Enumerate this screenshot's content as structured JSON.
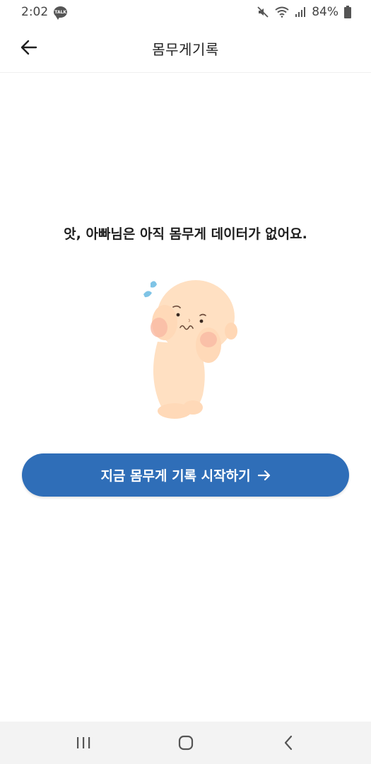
{
  "status_bar": {
    "time": "2:02",
    "talk_badge": "TALK",
    "battery": "84%"
  },
  "header": {
    "title": "몸무게기록"
  },
  "empty_state": {
    "message": "앗, 아빠님은 아직 몸무게 데이터가 없어요.",
    "button_label": "지금 몸무게 기록 시작하기"
  },
  "icons": {
    "back": "arrow-left-icon",
    "button_arrow": "arrow-right-icon",
    "nav_recents": "recent-apps-icon",
    "nav_home": "home-icon",
    "nav_back": "back-chevron-icon"
  },
  "colors": {
    "accent": "#2f6eb8",
    "nav_background": "#f3f3f3"
  }
}
